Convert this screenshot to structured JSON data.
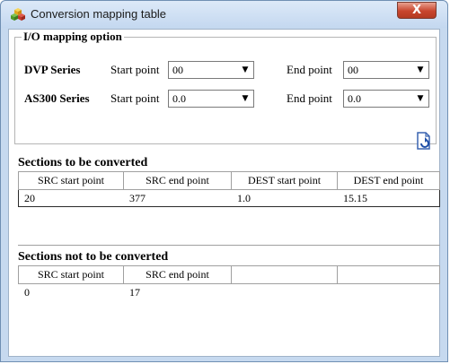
{
  "window": {
    "title": "Conversion mapping table",
    "close_label": "X"
  },
  "mapping": {
    "group_title": "I/O mapping option",
    "rows": [
      {
        "series": "DVP Series",
        "start_label": "Start point",
        "start_value": "00",
        "end_label": "End point",
        "end_value": "00"
      },
      {
        "series": "AS300 Series",
        "start_label": "Start point",
        "start_value": "0.0",
        "end_label": "End point",
        "end_value": "0.0"
      }
    ]
  },
  "converted": {
    "title": "Sections to be converted",
    "headers": [
      "SRC start point",
      "SRC end point",
      "DEST start point",
      "DEST end point"
    ],
    "rows": [
      [
        "20",
        "377",
        "1.0",
        "15.15"
      ]
    ]
  },
  "not_converted": {
    "title": "Sections not to be converted",
    "headers": [
      "SRC start point",
      "SRC end point",
      "",
      ""
    ],
    "rows": [
      [
        "0",
        "17",
        "",
        ""
      ]
    ]
  },
  "icons": {
    "app": "app-cubes-icon",
    "refresh": "refresh-document-icon",
    "dropdown": "chevron-down-icon"
  }
}
